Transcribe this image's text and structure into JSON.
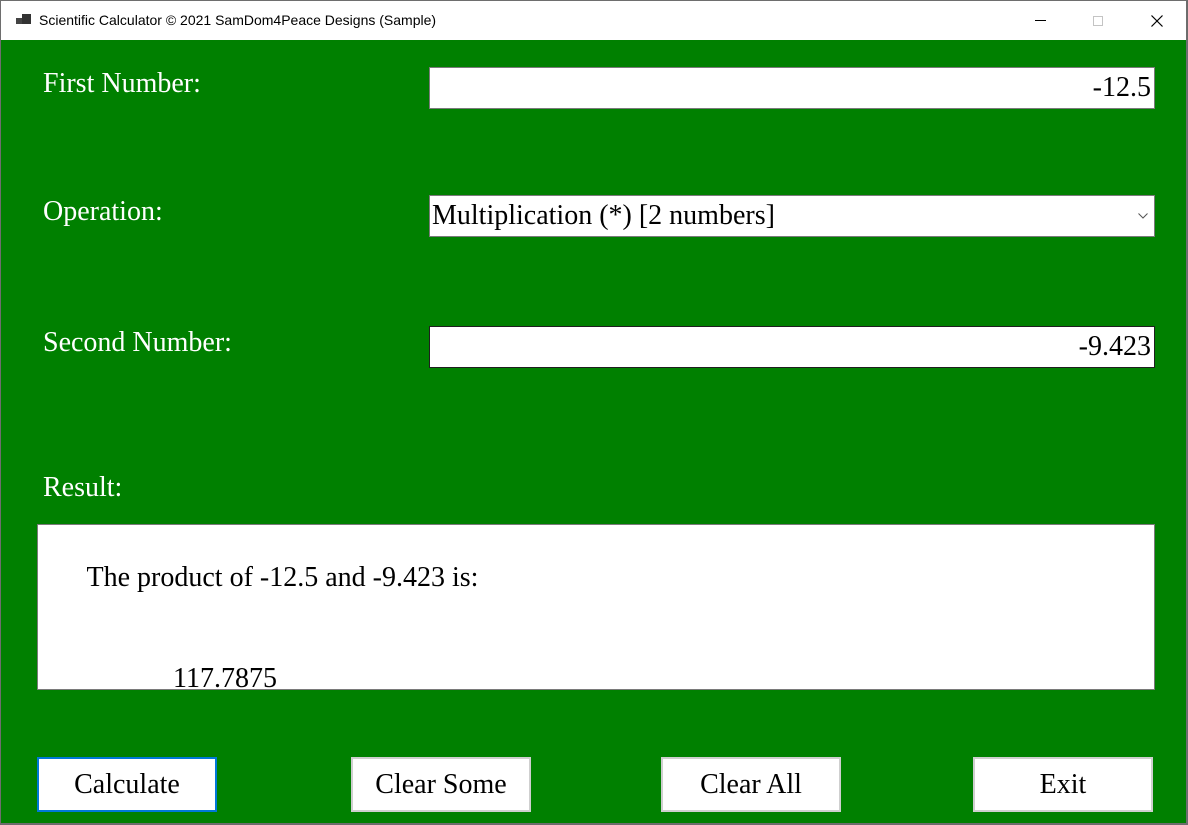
{
  "window": {
    "title": "Scientific Calculator © 2021 SamDom4Peace Designs (Sample)",
    "app_icon": "app-window-icon",
    "controls": {
      "minimize": "minimize-icon",
      "maximize": "maximize-icon",
      "close": "close-icon"
    }
  },
  "colors": {
    "background": "#008000",
    "label_text": "#ffffff",
    "focus_border": "#0078d7"
  },
  "form": {
    "first_number": {
      "label": "First Number:",
      "value": "-12.5"
    },
    "operation": {
      "label": "Operation:",
      "selected": "Multiplication (*) [2 numbers]",
      "icon": "chevron-down-icon"
    },
    "second_number": {
      "label": "Second Number:",
      "value": "-9.423"
    },
    "result": {
      "label": "Result:",
      "line1": "The product of -12.5 and -9.423 is:",
      "line2": "117.7875"
    }
  },
  "buttons": {
    "calculate": "Calculate",
    "clear_some": "Clear Some",
    "clear_all": "Clear All",
    "exit": "Exit"
  }
}
